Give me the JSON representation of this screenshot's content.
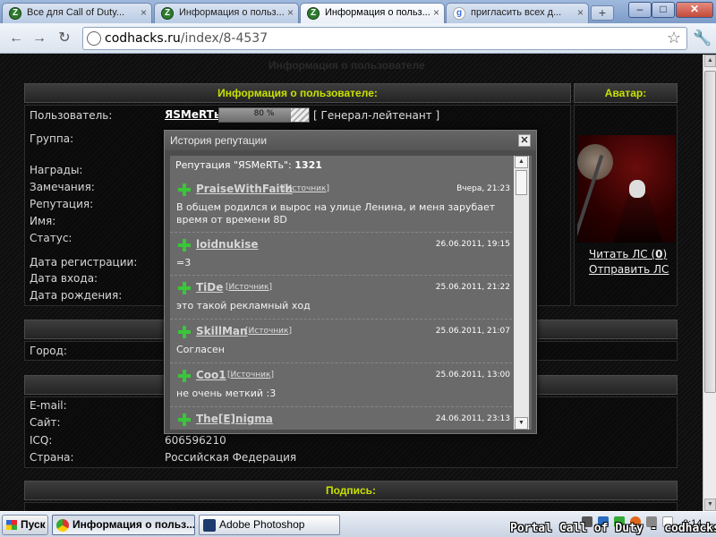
{
  "browser": {
    "tabs": [
      {
        "title": "Все для Call of Duty...",
        "favicon": "codhacks-icon"
      },
      {
        "title": "Информация о польз...",
        "favicon": "codhacks-icon"
      },
      {
        "title": "Информация о польз...",
        "favicon": "codhacks-icon",
        "active": true
      },
      {
        "title": "пригласить всех д...",
        "favicon": "google-icon"
      }
    ],
    "new_tab": "+",
    "url_host": "codhacks.ru",
    "url_path": "/index/8-4537",
    "window_buttons": {
      "minimize": "–",
      "maximize": "□",
      "close": "✕"
    }
  },
  "page": {
    "bg_title": "Информация о пользователе",
    "user_section": {
      "header": "Информация о пользователе:",
      "avatar_header": "Аватар:",
      "labels": [
        "Пользователь:",
        "Группа:",
        "Награды:",
        "Замечания:",
        "Репутация:",
        "Имя:",
        "Статус:",
        "Дата регистрации:",
        "Дата входа:",
        "Дата рождения:"
      ],
      "username": "ЯSMeRTь",
      "progress_text": "80 %",
      "progress_value": 0.8,
      "rank": "[ Генерал-лейтенант ]",
      "read_pm_prefix": "Читать ЛС (",
      "read_pm_count": "0",
      "read_pm_suffix": ")",
      "send_pm": "Отправить ЛС"
    },
    "city_label": "Город:",
    "contact_section": {
      "email_label": "E-mail:",
      "site_label": "Сайт:",
      "icq_label": "ICQ:",
      "icq_value": "606596210",
      "country_label": "Страна:",
      "country_value": "Российская Федерация"
    },
    "signature_header": "Подпись:"
  },
  "modal": {
    "title": "История репутации",
    "close": "✕",
    "summary_prefix": "Репутация \"ЯSMeRTь\": ",
    "summary_value": "1321",
    "source_label": "Источник",
    "entries": [
      {
        "nick": "PraiseWithFaith",
        "has_source": true,
        "date": "Вчера, 21:23",
        "message": "В общем родился и вырос на улице Ленина, и меня зарубает время от времени 8D"
      },
      {
        "nick": "loidnukise",
        "has_source": false,
        "date": "26.06.2011, 19:15",
        "message": "=3"
      },
      {
        "nick": "TiDe",
        "has_source": true,
        "date": "25.06.2011, 21:22",
        "message": "это такой рекламный ход"
      },
      {
        "nick": "SkillMan",
        "has_source": true,
        "date": "25.06.2011, 21:07",
        "message": "Согласен"
      },
      {
        "nick": "Coo1",
        "has_source": true,
        "date": "25.06.2011, 13:00",
        "message": "не очень меткий :3"
      },
      {
        "nick": "The[E]nigma",
        "has_source": true,
        "date": "24.06.2011, 23:13",
        "message": ""
      }
    ]
  },
  "taskbar": {
    "start": "Пуск",
    "buttons": [
      {
        "label": "Информация о польз...",
        "active": true
      },
      {
        "label": "Adobe Photoshop",
        "active": false
      }
    ],
    "watermark": "Portal Call of Duty - codhacks.ru",
    "clock": "0:14"
  }
}
